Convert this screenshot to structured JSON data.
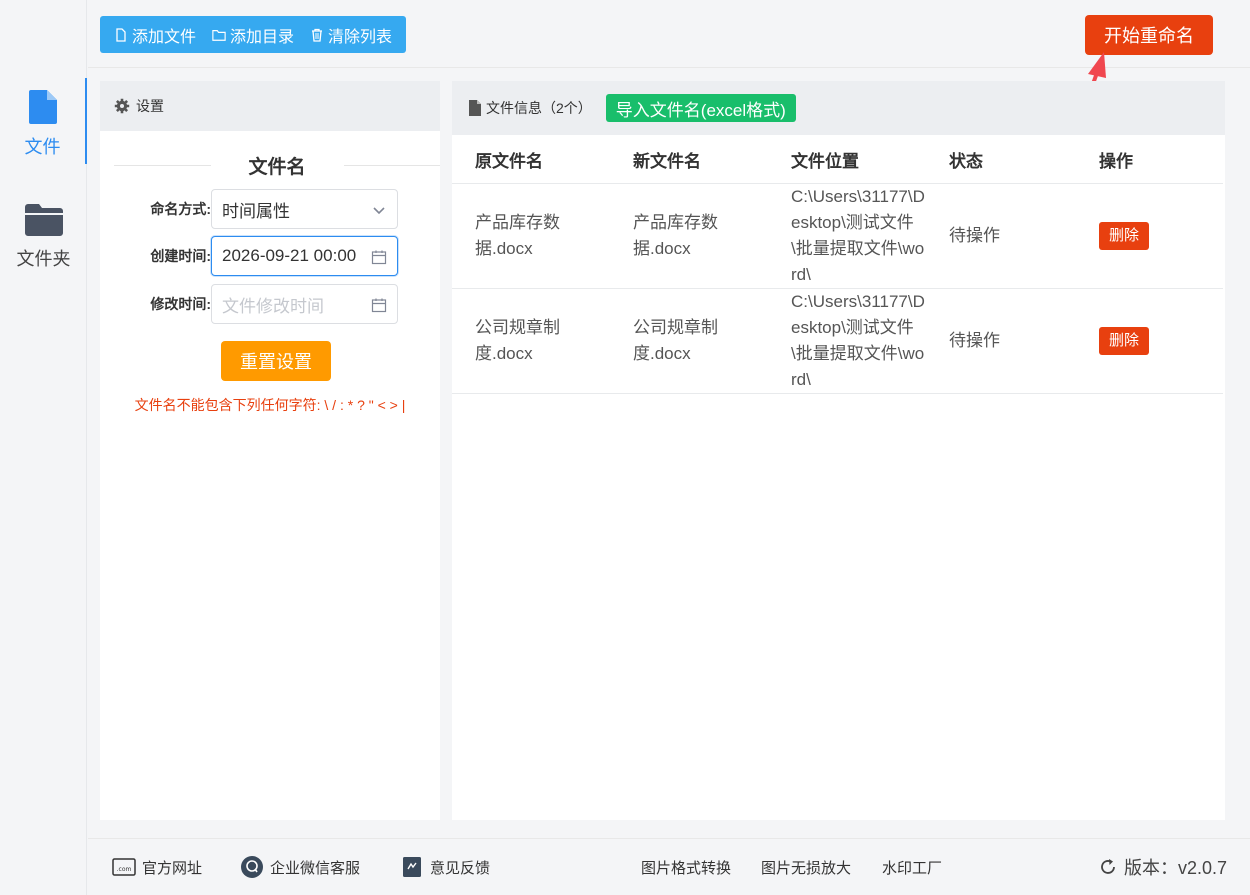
{
  "nav": {
    "file_label": "文件",
    "folder_label": "文件夹"
  },
  "toolbar": {
    "add_file": "添加文件",
    "add_dir": "添加目录",
    "clear_list": "清除列表",
    "start_rename": "开始重命名"
  },
  "settings": {
    "header": "设置",
    "section_title": "文件名",
    "naming_mode_label": "命名方式:",
    "naming_mode_value": "时间属性",
    "create_time_label": "创建时间:",
    "create_time_value": "2026-09-21 00:00",
    "modify_time_label": "修改时间:",
    "modify_time_placeholder": "文件修改时间",
    "reset_button": "重置设置",
    "warning": "文件名不能包含下列任何字符:  \\ / : * ? \" < > |"
  },
  "files": {
    "header": "文件信息（2个）",
    "import_button": "导入文件名(excel格式)",
    "columns": [
      "原文件名",
      "新文件名",
      "文件位置",
      "状态",
      "操作"
    ],
    "rows": [
      {
        "original": "产品库存数据.docx",
        "new": "产品库存数据.docx",
        "location": "C:\\Users\\31177\\Desktop\\测试文件\\批量提取文件\\word\\",
        "status": "待操作",
        "action": "删除"
      },
      {
        "original": "公司规章制度.docx",
        "new": "公司规章制度.docx",
        "location": "C:\\Users\\31177\\Desktop\\测试文件\\批量提取文件\\word\\",
        "status": "待操作",
        "action": "删除"
      }
    ]
  },
  "footer": {
    "official_site": "官方网址",
    "wechat_service": "企业微信客服",
    "feedback": "意见反馈",
    "img_convert": "图片格式转换",
    "img_enlarge": "图片无损放大",
    "watermark": "水印工厂",
    "version": "版本：v2.0.7"
  },
  "colors": {
    "primary_blue": "#2d8cf0",
    "toolbar_blue": "#36a9f0",
    "start_red": "#e8400f",
    "reset_orange": "#ff9a00",
    "import_green": "#19be6b"
  }
}
